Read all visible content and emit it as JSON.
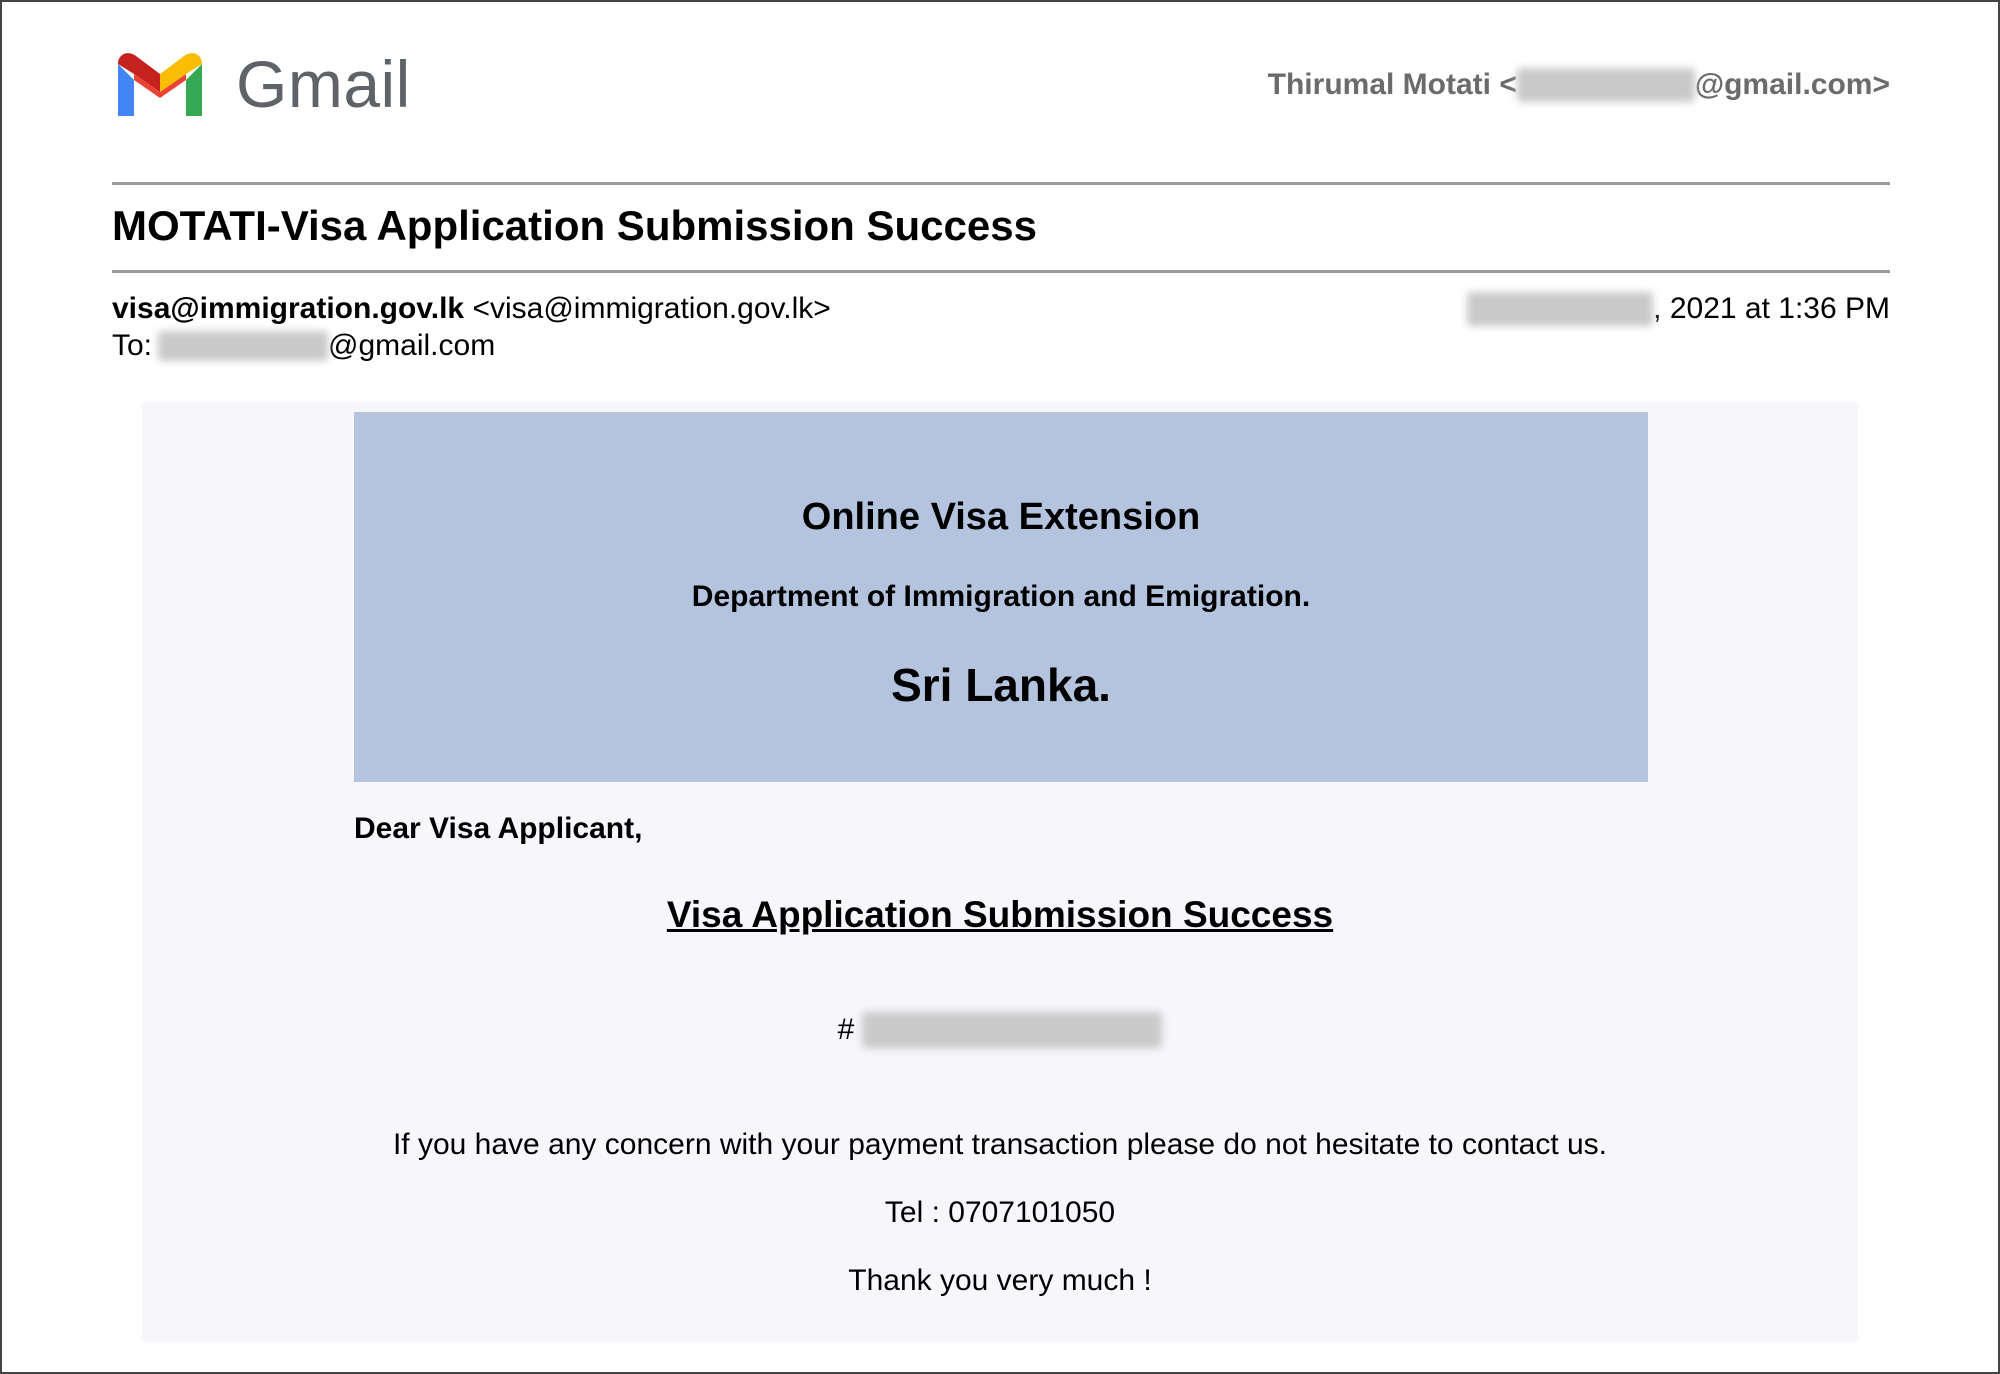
{
  "header": {
    "logo_icon": "gmail-m-logo",
    "app_name": "Gmail",
    "account_name": "Thirumal Motati <",
    "account_email_domain": "@gmail.com>"
  },
  "email": {
    "subject": "MOTATI-Visa Application Submission Success",
    "from_address": "visa@immigration.gov.lk",
    "from_display": "<visa@immigration.gov.lk>",
    "to_label": "To:",
    "to_domain": "@gmail.com",
    "date_suffix": ", 2021 at 1:36 PM"
  },
  "body": {
    "banner": {
      "title": "Online Visa Extension",
      "department": "Department of Immigration and Emigration.",
      "country": "Sri Lanka."
    },
    "greeting": "Dear Visa Applicant,",
    "heading": "Visa Application Submission Success",
    "reference_prefix": "#",
    "concern_text": "If you have any concern with your payment transaction please do not hesitate to contact us.",
    "tel_text": "Tel : 0707101050",
    "thanks_text": "Thank you very much !"
  },
  "colors": {
    "banner_bg": "#b4c4df",
    "body_bg": "#f6f6fb",
    "gmail_red": "#ea4335",
    "gmail_blue": "#4285f4",
    "gmail_green": "#34a853",
    "gmail_yellow": "#fbbc04",
    "gmail_dark_red": "#c5221f"
  }
}
